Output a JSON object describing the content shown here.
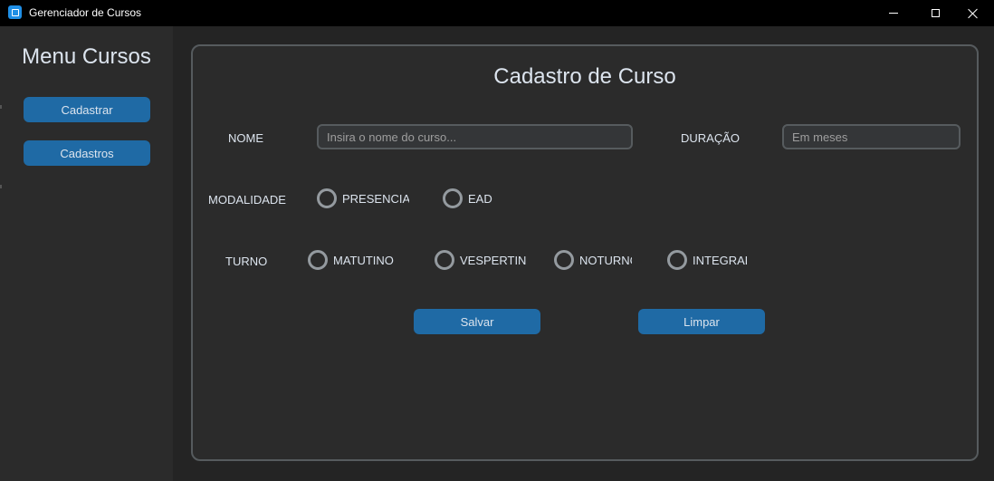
{
  "window": {
    "title": "Gerenciador de Cursos",
    "controls": [
      "minimize-icon",
      "maximize-icon",
      "close-icon"
    ]
  },
  "sidebar": {
    "title": "Menu Cursos",
    "buttons": [
      {
        "label": "Cadastrar"
      },
      {
        "label": "Cadastros"
      }
    ]
  },
  "form": {
    "title": "Cadastro de Curso",
    "nome": {
      "label": "NOME",
      "placeholder": "Insira o nome do curso..."
    },
    "duracao": {
      "label": "DURAÇÃO",
      "placeholder": "Em meses"
    },
    "modalidade": {
      "label": "MODALIDADE",
      "options": [
        "PRESENCIAL",
        "EAD"
      ]
    },
    "turno": {
      "label": "TURNO",
      "options": [
        "MATUTINO",
        "VESPERTINC",
        "NOTURNC",
        "INTEGRAL"
      ]
    },
    "buttons": {
      "save": "Salvar",
      "clear": "Limpar"
    }
  },
  "colors": {
    "accent": "#1f6aa5",
    "background": "#242424",
    "panel": "#2b2b2b",
    "titlebar": "#000000",
    "text": "#dce4ee",
    "border": "#565b5e"
  }
}
